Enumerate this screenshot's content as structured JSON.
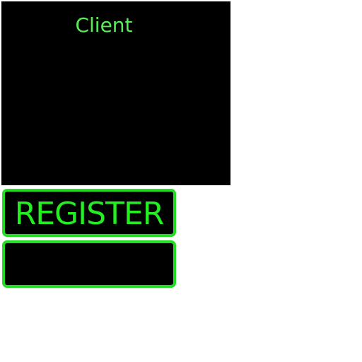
{
  "client_panel": {
    "title": "Client"
  },
  "buttons": {
    "register_label": "REGISTER",
    "second_label": ""
  },
  "colors": {
    "panel_background": "#000000",
    "title_text": "#55ee55",
    "button_border": "#22dd22",
    "button_text": "#22ee22",
    "page_background": "#ffffff"
  }
}
